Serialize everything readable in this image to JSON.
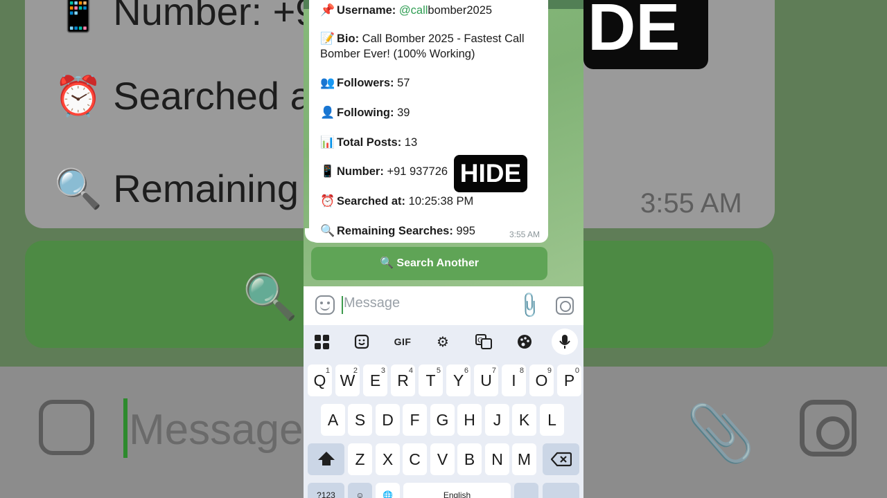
{
  "background": {
    "lines": [
      {
        "emoji": "📱",
        "text": "Number: +9"
      },
      {
        "emoji": "⏰",
        "text": "Searched a"
      },
      {
        "emoji": "🔍",
        "text": "Remaining"
      }
    ],
    "time": "3:55 AM",
    "hide_label": "DE",
    "message_placeholder": "Message"
  },
  "chat": {
    "username": {
      "emoji": "📌",
      "label": "Username:",
      "value_link": "@call",
      "value_rest": "bomber2025"
    },
    "bio": {
      "emoji": "📝",
      "label": "Bio:",
      "value": "Call Bomber 2025 - Fastest Call Bomber Ever! (100% Working)"
    },
    "followers": {
      "emoji": "👥",
      "label": "Followers:",
      "value": "57"
    },
    "following": {
      "emoji": "👤",
      "label": "Following:",
      "value": "39"
    },
    "posts": {
      "emoji": "📊",
      "label": "Total Posts:",
      "value": "13"
    },
    "number": {
      "emoji": "📱",
      "label": "Number:",
      "value": "+91 937726"
    },
    "searched": {
      "emoji": "⏰",
      "label": "Searched at:",
      "value": "10:25:38 PM"
    },
    "remaining": {
      "emoji": "🔍",
      "label": "Remaining Searches:",
      "value": "995"
    },
    "time": "3:55 AM",
    "hide_badge": "HIDE"
  },
  "button": {
    "icon": "🔍",
    "label": "Search Another"
  },
  "input": {
    "placeholder": "Message"
  },
  "keyboard": {
    "toolbar": [
      "apps-grid-icon",
      "sticker-icon",
      "GIF",
      "settings-icon",
      "translate-icon",
      "palette-icon",
      "mic-icon"
    ],
    "gif_label": "GIF",
    "row1": [
      {
        "k": "Q",
        "n": "1"
      },
      {
        "k": "W",
        "n": "2"
      },
      {
        "k": "E",
        "n": "3"
      },
      {
        "k": "R",
        "n": "4"
      },
      {
        "k": "T",
        "n": "5"
      },
      {
        "k": "Y",
        "n": "6"
      },
      {
        "k": "U",
        "n": "7"
      },
      {
        "k": "I",
        "n": "8"
      },
      {
        "k": "O",
        "n": "9"
      },
      {
        "k": "P",
        "n": "0"
      }
    ],
    "row2": [
      "A",
      "S",
      "D",
      "F",
      "G",
      "H",
      "J",
      "K",
      "L"
    ],
    "row3": [
      "Z",
      "X",
      "C",
      "V",
      "B",
      "N",
      "M"
    ],
    "bottom": {
      "sym": "?123",
      "emoji": "☺",
      "globe": "🌐",
      "space": "English"
    }
  }
}
